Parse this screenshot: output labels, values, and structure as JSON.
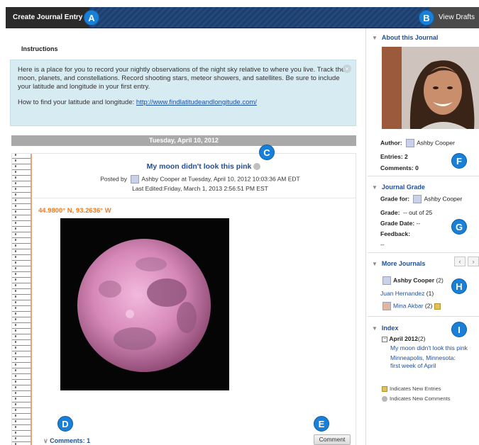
{
  "topbar": {
    "create_label": "Create Journal Entry",
    "drafts_label": "View Drafts",
    "callout_a": "A",
    "callout_b": "B"
  },
  "instructions": {
    "title": "Instructions",
    "body": "Here is a place for you to record your nightly observations of the night sky relative to where you live. Track the moon, planets, and constellations. Record shooting stars, meteor showers, and satellites. Be sure to include your latitude and longitude in your first entry.",
    "how_prefix": "How to find your latitude and longitude: ",
    "link": "http://www.findlatitudeandlongitude.com/"
  },
  "date_bar": "Tuesday, April 10, 2012",
  "entry": {
    "title": "My moon didn't look this pink",
    "posted_by_label": "Posted by",
    "author": "Ashby Cooper",
    "posted_at": " at Tuesday, April 10, 2012 10:03:36 AM EDT",
    "last_edited": "Last Edited:Friday, March 1, 2013 2:56:51 PM EST",
    "coordinates": "44.9800° N, 93.2636° W",
    "comments_link": "Comments: 1",
    "comment_button": "Comment",
    "callout_c": "C",
    "callout_d": "D",
    "callout_e": "E"
  },
  "sidebar": {
    "about_title": "About this Journal",
    "author_label": "Author:",
    "author_name": "Ashby Cooper",
    "entries": "Entries: 2",
    "comments": "Comments: 0",
    "callout_f": "F",
    "grade_title": "Journal Grade",
    "grade_for_label": "Grade for:",
    "grade_for_name": "Ashby Cooper",
    "grade_label": "Grade:",
    "grade_value": "-- out of 25",
    "grade_date_label": "Grade Date:",
    "grade_date_value": "--",
    "feedback_label": "Feedback:",
    "feedback_value": "--",
    "callout_g": "G",
    "more_title": "More Journals",
    "more_items": [
      {
        "name": "Ashby Cooper",
        "count": "(2)"
      },
      {
        "name": "Juan Hernandez",
        "count": "(1)"
      },
      {
        "name": "Mina Akbar",
        "count": "(2)"
      }
    ],
    "callout_h": "H",
    "index_title": "Index",
    "index_month": "April 2012",
    "index_month_count": "(2)",
    "index_links": [
      "My moon didn't look this pink",
      "Minneapolis, Minnesota: first week of April"
    ],
    "callout_i": "I",
    "legend_new_entries": "Indicates New Entries",
    "legend_new_comments": "Indicates New Comments"
  },
  "colors": {
    "header": "#1c3f6e",
    "link": "#1f4f99",
    "accent_orange": "#f07a1f",
    "callout": "#1a7fd6",
    "instructions_bg": "#d7ebf2"
  }
}
